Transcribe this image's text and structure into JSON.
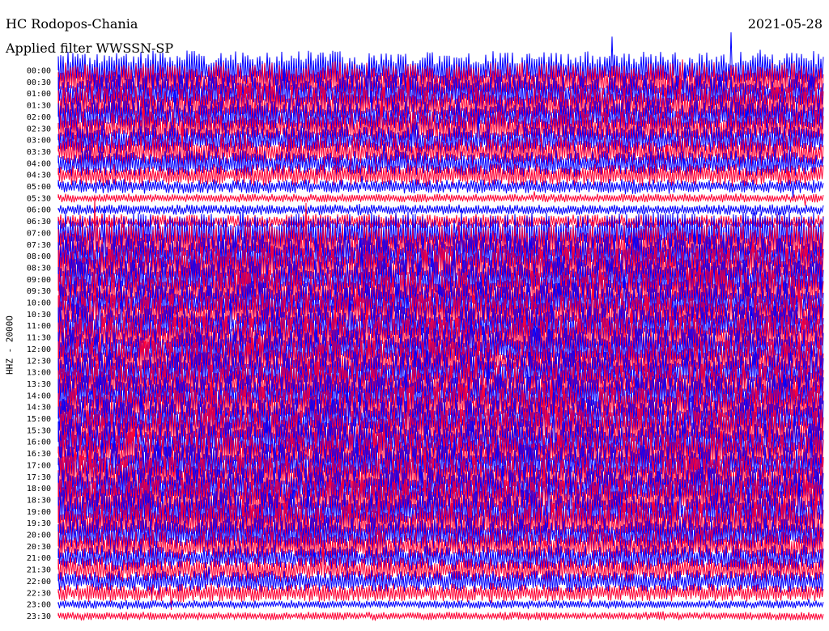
{
  "header": {
    "station": "HC Rodopos-Chania",
    "date": "2021-05-28",
    "filter": "Applied filter WWSSN-SP",
    "channel": "HHZ - 2000O"
  },
  "chart_data": {
    "type": "line",
    "subtype": "helicorder",
    "colors": [
      "#0000ff",
      "#ff0033"
    ],
    "time_labels": [
      "00:00",
      "00:30",
      "01:00",
      "01:30",
      "02:00",
      "02:30",
      "03:00",
      "03:30",
      "04:00",
      "04:30",
      "05:00",
      "05:30",
      "06:00",
      "06:30",
      "07:00",
      "07:30",
      "08:00",
      "08:30",
      "09:00",
      "09:30",
      "10:00",
      "10:30",
      "11:00",
      "11:30",
      "12:00",
      "12:30",
      "13:00",
      "13:30",
      "14:00",
      "14:30",
      "15:00",
      "15:30",
      "16:00",
      "16:30",
      "17:00",
      "17:30",
      "18:00",
      "18:30",
      "19:00",
      "19:30",
      "20:00",
      "20:30",
      "21:00",
      "21:30",
      "22:00",
      "22:30",
      "23:00",
      "23:30"
    ],
    "trace_amplitude": [
      0.9,
      0.9,
      0.9,
      0.9,
      0.8,
      0.8,
      0.7,
      0.7,
      0.6,
      0.5,
      0.3,
      0.15,
      0.2,
      0.3,
      1.0,
      1.0,
      1.0,
      1.0,
      1.0,
      1.0,
      1.0,
      1.0,
      1.0,
      1.0,
      1.0,
      1.0,
      1.0,
      1.0,
      1.0,
      1.0,
      1.0,
      1.0,
      1.0,
      1.0,
      1.0,
      1.0,
      1.0,
      1.0,
      1.0,
      1.0,
      0.8,
      0.7,
      0.6,
      0.6,
      0.5,
      0.4,
      0.15,
      0.15
    ]
  }
}
